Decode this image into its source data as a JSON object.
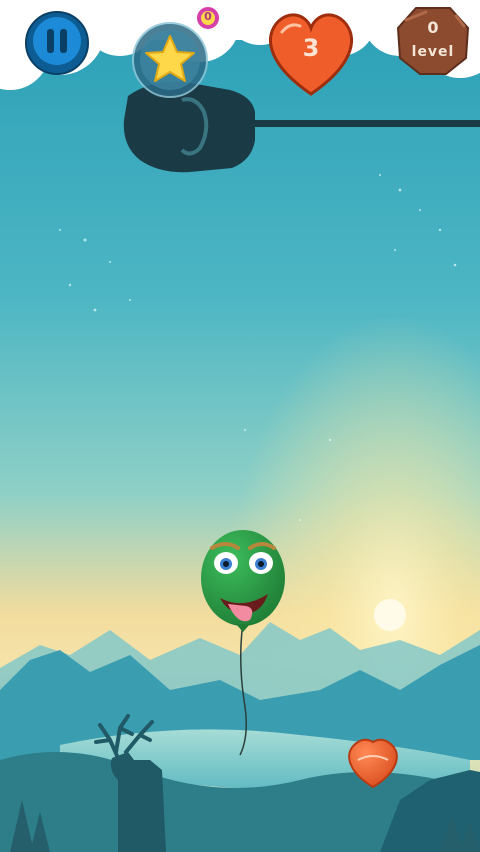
{
  "hud": {
    "pause_icon": "pause-icon",
    "star_icon": "star-icon",
    "star_badge_count": "0",
    "heart_icon": "heart-icon",
    "lives": "3",
    "level_icon": "cookie-icon",
    "level_number": "0",
    "level_label": "level"
  },
  "scene": {
    "balloon_color": "#2e9a4a",
    "sky_top": "#2aa2b8",
    "sky_mid": "#5cc2c8",
    "horizon": "#f4dc9a",
    "mountain_color": "#3a9db0",
    "lake_color": "#79c9cc",
    "silhouette_color": "#1f5a66",
    "heart_color": "#e85a2c"
  }
}
